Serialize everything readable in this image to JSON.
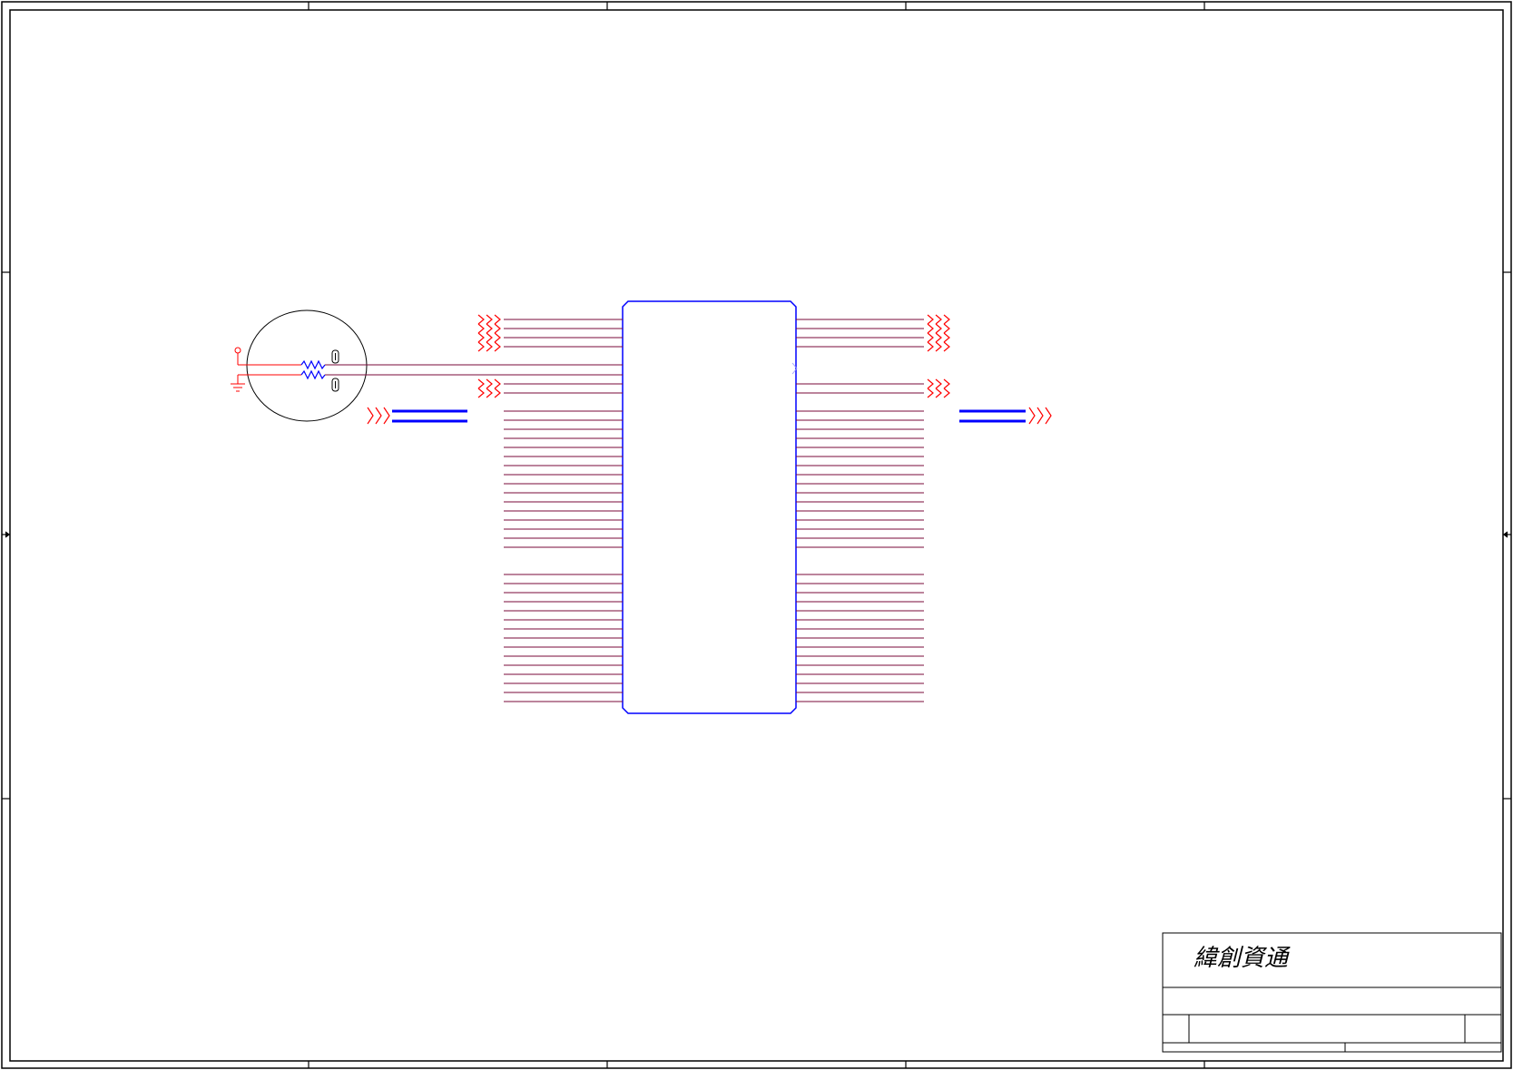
{
  "title_block": {
    "company_name": "緯創資通"
  },
  "colors": {
    "frame": "#000000",
    "net_wire": "#7a0a3a",
    "offpage_connector": "#ff0000",
    "component": "#0000ff",
    "bus": "#0000ff",
    "power_ground": "#ff0000"
  },
  "icons": {
    "power_symbol": "power-rail-icon",
    "ground_symbol": "ground-icon",
    "resistor": "resistor-icon",
    "capacitor": "capacitor-icon",
    "offpage_connector": "offpage-connector-icon"
  }
}
